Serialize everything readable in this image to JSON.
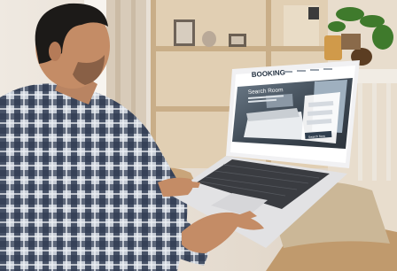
{
  "photo": {
    "subject": "Man in plaid shirt using a laptop with a booking website on screen"
  },
  "laptop_screen": {
    "brand": "BOOKING",
    "hero_heading": "Search Room",
    "search_button": "Search Now"
  },
  "colors": {
    "wall": "#e6dccf",
    "shelf_wood": "#d9c3a3",
    "shirt_dark": "#2e3a4f",
    "shirt_light": "#c9cfd8",
    "skin": "#c8906a",
    "laptop": "#e4e4e6",
    "keyboard": "#3b3d42",
    "chair": "#c9a57a"
  }
}
